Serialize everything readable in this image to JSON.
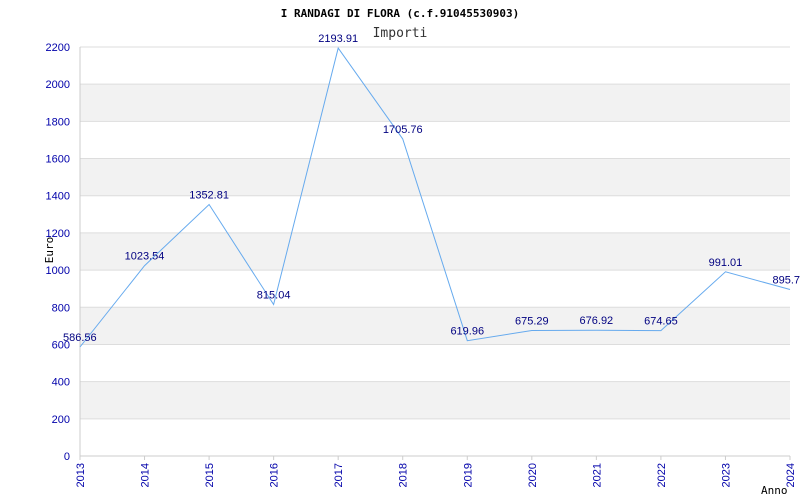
{
  "chart_data": {
    "type": "line",
    "title": "I RANDAGI DI FLORA (c.f.91045530903)",
    "subtitle": "Importi",
    "xlabel": "Anno",
    "ylabel": "Euro",
    "ylim": [
      0,
      2200
    ],
    "yticks": [
      0,
      200,
      400,
      600,
      800,
      1000,
      1200,
      1400,
      1600,
      1800,
      2000,
      2200
    ],
    "categories": [
      "2013",
      "2014",
      "2015",
      "2016",
      "2017",
      "2018",
      "2019",
      "2020",
      "2021",
      "2022",
      "2023",
      "2024"
    ],
    "values": [
      586.56,
      1023.54,
      1352.81,
      815.04,
      2193.91,
      1705.76,
      619.96,
      675.29,
      676.92,
      674.65,
      991.01,
      895.7
    ],
    "data_labels": [
      "586.56",
      "1023.54",
      "1352.81",
      "815.04",
      "2193.91",
      "1705.76",
      "619.96",
      "675.29",
      "676.92",
      "674.65",
      "991.01",
      "895.7"
    ],
    "grid": true,
    "colors": {
      "line": "#66aaee",
      "band": "#f2f2f2",
      "grid": "#dddddd",
      "tick_text": "#0000aa",
      "label_text": "#000080"
    }
  }
}
